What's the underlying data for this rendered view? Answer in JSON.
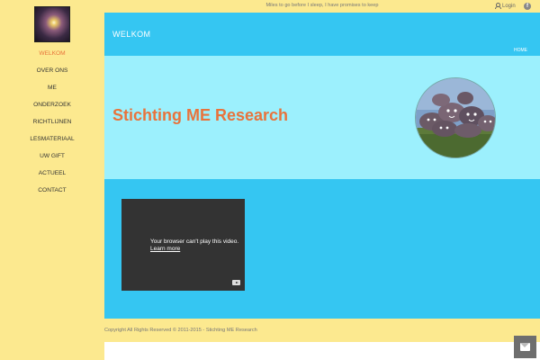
{
  "sidebar": {
    "logo_icon": "night-sky-logo-icon",
    "items": [
      {
        "label": "WELKOM",
        "active": true
      },
      {
        "label": "OVER ONS"
      },
      {
        "label": "ME"
      },
      {
        "label": "ONDERZOEK"
      },
      {
        "label": "RICHTLIJNEN"
      },
      {
        "label": "LESMATERIAAL"
      },
      {
        "label": "UW GIFT"
      },
      {
        "label": "ACTUEEL"
      },
      {
        "label": "CONTACT"
      }
    ]
  },
  "topbar": {
    "tagline": "Miles to go before I sleep, I have promises to keep",
    "login_label": "Login",
    "facebook_icon": "facebook-icon",
    "facebook_glyph": "f"
  },
  "header": {
    "title": "WELKOM",
    "breadcrumb": "HOME"
  },
  "hero": {
    "title": "Stichting ME Research",
    "image_icon": "painted-rocks-image"
  },
  "video": {
    "message": "Your browser can't play this video.",
    "link": "Learn more",
    "logo_icon": "youtube-icon"
  },
  "footer": {
    "copyright": "Copyright All Rights Reserved © 2011-2015 - Stichting ME Research"
  },
  "colors": {
    "sidebar_bg": "#fce98f",
    "header_bg": "#35c6f2",
    "hero_bg": "#9cf0fd",
    "accent": "#e8743b"
  },
  "message_button_icon": "envelope-icon"
}
